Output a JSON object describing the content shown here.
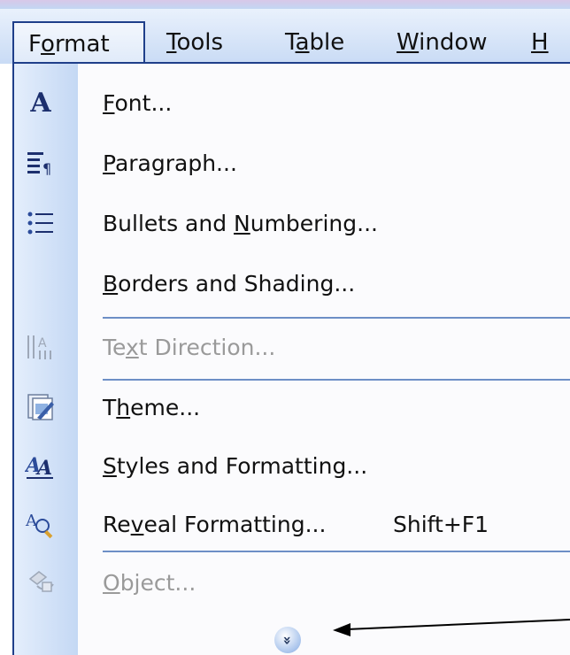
{
  "menubar": {
    "items": [
      {
        "pre": "F",
        "u": "o",
        "post": "rmat"
      },
      {
        "pre": "",
        "u": "T",
        "post": "ools"
      },
      {
        "pre": "T",
        "u": "a",
        "post": "ble"
      },
      {
        "pre": "",
        "u": "W",
        "post": "indow"
      },
      {
        "pre": "",
        "u": "H",
        "post": ""
      }
    ]
  },
  "menu": {
    "items": [
      {
        "icon": "font-icon",
        "pre": "",
        "u": "F",
        "post": "ont...",
        "disabled": false
      },
      {
        "icon": "paragraph-icon",
        "pre": "",
        "u": "P",
        "post": "aragraph...",
        "disabled": false
      },
      {
        "icon": "bullets-icon",
        "pre": "Bullets and ",
        "u": "N",
        "post": "umbering...",
        "disabled": false
      },
      {
        "icon": "",
        "pre": "",
        "u": "B",
        "post": "orders and Shading...",
        "disabled": false
      },
      {
        "icon": "text-direction-icon",
        "pre": "Te",
        "u": "x",
        "post": "t Direction...",
        "disabled": true
      },
      {
        "icon": "theme-icon",
        "pre": "T",
        "u": "h",
        "post": "eme...",
        "disabled": false
      },
      {
        "icon": "styles-icon",
        "pre": "",
        "u": "S",
        "post": "tyles and Formatting...",
        "disabled": false
      },
      {
        "icon": "reveal-formatting-icon",
        "pre": "Re",
        "u": "v",
        "post": "eal Formatting...",
        "shortcut": "Shift+F1",
        "disabled": false
      },
      {
        "icon": "object-icon",
        "pre": "",
        "u": "O",
        "post": "bject...",
        "disabled": true
      }
    ],
    "expand_glyph": "»"
  },
  "icon_glyphs": {
    "font": "A",
    "paragraph": "¶",
    "bullets": "☰",
    "text_direction": "A",
    "styles": "A",
    "reveal": "A"
  },
  "colors": {
    "menu_border": "#1f3f8a",
    "separator": "#6d8fc6",
    "gutter": "#c4d8f4"
  }
}
